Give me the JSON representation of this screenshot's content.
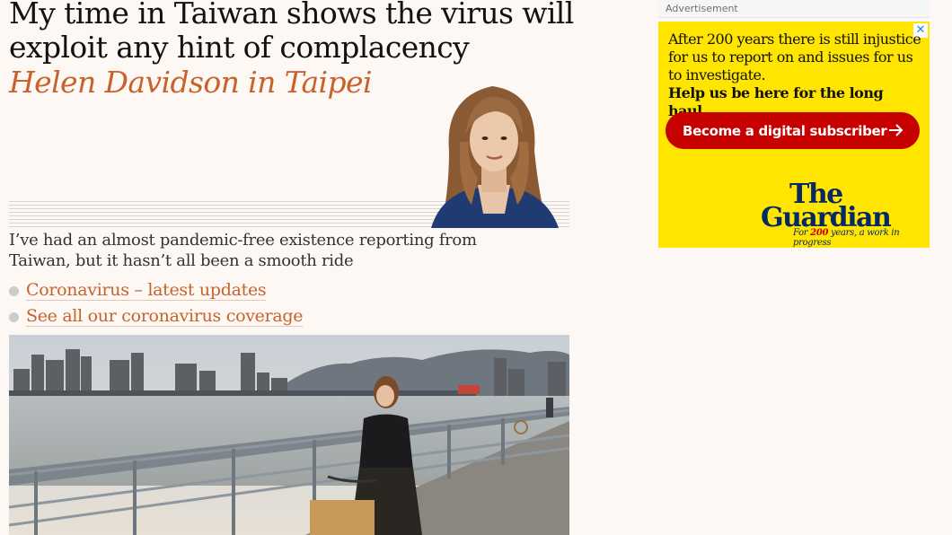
{
  "article": {
    "headline": "My time in Taiwan shows the virus will exploit any hint of complacency",
    "byline": "Helen Davidson in Taipei",
    "standfirst": "I’ve had an almost pandemic-free existence reporting from Taiwan, but it hasn’t all been a smooth ride",
    "links": [
      {
        "label": "Coronavirus – latest updates"
      },
      {
        "label": "See all our coronavirus coverage"
      }
    ]
  },
  "ad": {
    "label": "Advertisement",
    "close_icon": "close-icon",
    "copy_1": "After 200 years there is still injustice for us to report on and issues for us to investigate.",
    "copy_2": "Help us be here for the long haul.",
    "button": "Become a digital subscriber",
    "logo_the": "The",
    "logo_guardian": "Guardian",
    "tagline_prefix": "For ",
    "tagline_number": "200",
    "tagline_suffix": " years, a work in progress"
  },
  "colors": {
    "background": "#fdf8f4",
    "byline": "#c8622b",
    "ad_yellow": "#ffe500",
    "ad_red": "#c70000",
    "guardian_blue": "#052962"
  }
}
